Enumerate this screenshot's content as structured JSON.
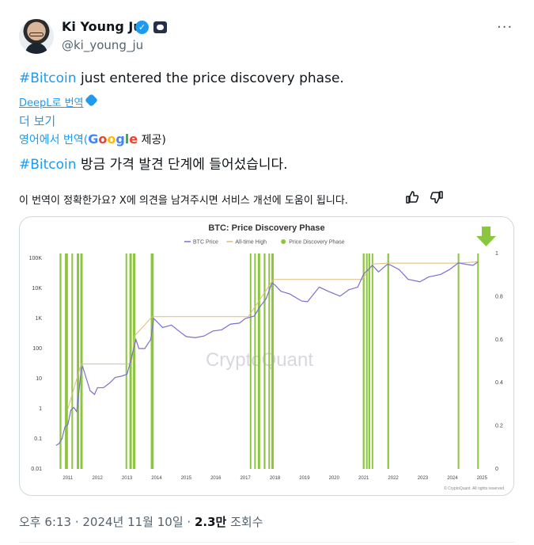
{
  "author": {
    "name": "Ki Young Ju",
    "handle": "@ki_young_ju",
    "verified_icon": "verified-check-icon",
    "org_badge_icon": "affiliate-badge-icon"
  },
  "tweet": {
    "hashtag": "#Bitcoin",
    "text": " just entered the price discovery phase.",
    "deepl_label": "DeepL로 번역",
    "show_more": "더 보기",
    "translation_prefix": "영어에서 번역(",
    "translation_google": "Google",
    "translation_suffix": " 제공)",
    "translated_hashtag": "#Bitcoin",
    "translated_text": " 방금 가격 발견 단계에 들어섰습니다.",
    "feedback": "이 번역이 정확한가요? X에 의견을 남겨주시면 서비스 개선에 도움이 됩니다."
  },
  "meta": {
    "time": "오후 6:13 · 2024년 11월 10일 · ",
    "views": "2.3만",
    "views_label": " 조회수"
  },
  "colors": {
    "accent": "#1d9bf0",
    "price_line": "#7b6fd0",
    "ath_line": "#e0b97a",
    "phase_bar": "#8cc63f",
    "arrow": "#8cc63f"
  },
  "chart_data": {
    "type": "line",
    "title": "BTC: Price Discovery Phase",
    "legend": [
      "BTC Price",
      "All-time High",
      "Price Discovery Phase"
    ],
    "legend_position": "top-center",
    "watermark": "CryptoQuant",
    "footer": "© CryptoQuant. All rights reserved",
    "y_left_ticks": [
      "100K",
      "10K",
      "1K",
      "100",
      "10",
      "1",
      "0.1",
      "0.01"
    ],
    "y_right_ticks": [
      "1",
      "0.8",
      "0.6",
      "0.4",
      "0.2",
      "0"
    ],
    "x_ticks": [
      "2011",
      "2012",
      "2013",
      "2014",
      "2015",
      "2016",
      "2017",
      "2018",
      "2019",
      "2020",
      "2021",
      "2022",
      "2023",
      "2024",
      "2025"
    ],
    "y_scale": "log",
    "ylim": [
      0.01,
      100000
    ],
    "xlim": [
      2010.55,
      2025.1
    ],
    "price_series": {
      "name": "BTC Price",
      "points": [
        [
          2010.6,
          0.06
        ],
        [
          2010.7,
          0.07
        ],
        [
          2010.8,
          0.1
        ],
        [
          2010.9,
          0.25
        ],
        [
          2011.0,
          0.3
        ],
        [
          2011.1,
          0.9
        ],
        [
          2011.2,
          1.1
        ],
        [
          2011.3,
          0.8
        ],
        [
          2011.45,
          20
        ],
        [
          2011.5,
          25
        ],
        [
          2011.6,
          12
        ],
        [
          2011.75,
          4
        ],
        [
          2011.9,
          3
        ],
        [
          2012.0,
          5
        ],
        [
          2012.2,
          5
        ],
        [
          2012.4,
          7
        ],
        [
          2012.6,
          11
        ],
        [
          2012.8,
          12
        ],
        [
          2013.0,
          14
        ],
        [
          2013.15,
          50
        ],
        [
          2013.3,
          200
        ],
        [
          2013.4,
          100
        ],
        [
          2013.6,
          100
        ],
        [
          2013.8,
          200
        ],
        [
          2013.9,
          1000
        ],
        [
          2014.0,
          800
        ],
        [
          2014.2,
          500
        ],
        [
          2014.5,
          600
        ],
        [
          2014.8,
          350
        ],
        [
          2015.0,
          250
        ],
        [
          2015.3,
          230
        ],
        [
          2015.6,
          260
        ],
        [
          2015.9,
          380
        ],
        [
          2016.2,
          420
        ],
        [
          2016.5,
          650
        ],
        [
          2016.8,
          700
        ],
        [
          2017.0,
          1000
        ],
        [
          2017.3,
          1200
        ],
        [
          2017.5,
          2500
        ],
        [
          2017.7,
          4500
        ],
        [
          2017.9,
          15000
        ],
        [
          2018.0,
          13000
        ],
        [
          2018.2,
          8000
        ],
        [
          2018.5,
          6500
        ],
        [
          2018.9,
          3800
        ],
        [
          2019.1,
          3600
        ],
        [
          2019.5,
          11000
        ],
        [
          2019.8,
          8000
        ],
        [
          2020.2,
          5500
        ],
        [
          2020.5,
          9000
        ],
        [
          2020.8,
          11000
        ],
        [
          2021.0,
          30000
        ],
        [
          2021.3,
          58000
        ],
        [
          2021.5,
          35000
        ],
        [
          2021.8,
          63000
        ],
        [
          2021.9,
          60000
        ],
        [
          2022.2,
          42000
        ],
        [
          2022.5,
          20000
        ],
        [
          2022.9,
          16500
        ],
        [
          2023.2,
          24000
        ],
        [
          2023.6,
          29000
        ],
        [
          2023.9,
          42000
        ],
        [
          2024.2,
          70000
        ],
        [
          2024.5,
          62000
        ],
        [
          2024.7,
          58000
        ],
        [
          2024.86,
          76000
        ]
      ]
    },
    "ath_series": {
      "name": "All-time High",
      "points": [
        [
          2011.0,
          1
        ],
        [
          2011.45,
          31
        ],
        [
          2013.15,
          31
        ],
        [
          2013.25,
          260
        ],
        [
          2013.85,
          1150
        ],
        [
          2017.1,
          1150
        ],
        [
          2017.95,
          19800
        ],
        [
          2020.95,
          19800
        ],
        [
          2021.3,
          64000
        ],
        [
          2021.8,
          69000
        ],
        [
          2024.2,
          69000
        ],
        [
          2024.86,
          76000
        ]
      ]
    },
    "phase_bars": [
      [
        2010.72,
        2010.78
      ],
      [
        2010.9,
        2011.0
      ],
      [
        2011.12,
        2011.16
      ],
      [
        2011.3,
        2011.38
      ],
      [
        2011.42,
        2011.5
      ],
      [
        2012.95,
        2013.0
      ],
      [
        2013.08,
        2013.16
      ],
      [
        2013.2,
        2013.28
      ],
      [
        2013.8,
        2013.9
      ],
      [
        2017.15,
        2017.2
      ],
      [
        2017.3,
        2017.34
      ],
      [
        2017.42,
        2017.5
      ],
      [
        2017.62,
        2017.68
      ],
      [
        2017.78,
        2017.82
      ],
      [
        2017.88,
        2017.96
      ],
      [
        2020.97,
        2021.03
      ],
      [
        2021.08,
        2021.12
      ],
      [
        2021.16,
        2021.22
      ],
      [
        2021.27,
        2021.32
      ],
      [
        2021.8,
        2021.86
      ],
      [
        2024.18,
        2024.22
      ],
      [
        2024.84,
        2024.88
      ]
    ]
  }
}
